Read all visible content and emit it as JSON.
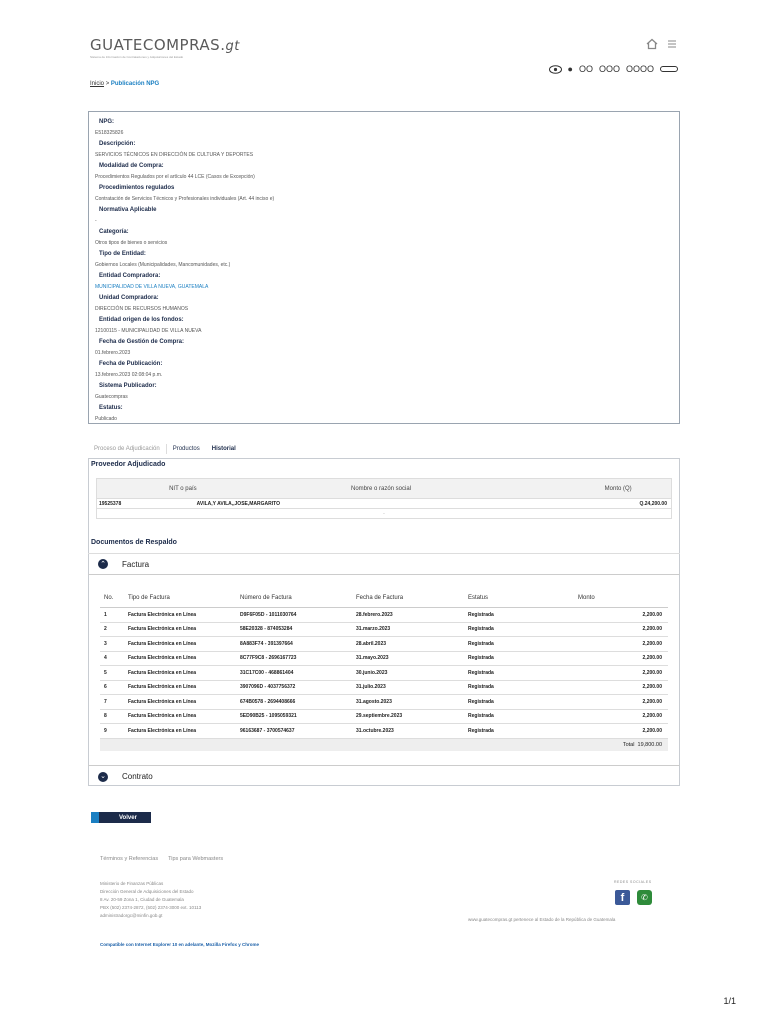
{
  "header": {
    "logo_text": "GUATECOMPRAS.",
    "logo_suffix": "gt",
    "logo_subtext": "Sistema de Información de Contrataciones y Adquisiciones del Estado",
    "access_bar": [
      "●",
      "OO",
      "OOO",
      "OOOO"
    ]
  },
  "breadcrumb": {
    "home": "Inicio",
    "separator": ">",
    "current": "Publicación NPG"
  },
  "detail": {
    "npg_label": "NPG:",
    "npg_value": "E518325826",
    "fields": [
      {
        "label": "Descripción:",
        "value": "SERVICIOS TÉCNICOS EN DIRECCIÓN DE CULTURA Y DEPORTES"
      },
      {
        "label": "Modalidad de Compra:",
        "value": "Procedimientos Regulados por el artículo 44 LCE (Casos de Excepción)"
      },
      {
        "label": "Procedimientos regulados",
        "value": "Contratación de Servicios Técnicos y Profesionales individuales (Art. 44 inciso e)"
      },
      {
        "label": "Normativa Aplicable",
        "value": "-"
      },
      {
        "label": "Categoría:",
        "value": "Otros tipos de bienes o servicios"
      },
      {
        "label": "Tipo de Entidad:",
        "value": "Gobiernos Locales (Municipalidades, Mancomunidades, etc.)"
      },
      {
        "label": "Entidad Compradora:",
        "value": "MUNICIPALIDAD DE VILLA NUEVA, GUATEMALA"
      },
      {
        "label": "Unidad Compradora:",
        "value": "DIRECCIÓN DE RECURSOS HUMANOS"
      },
      {
        "label": "Entidad origen de los fondos:",
        "value": "12100115 - MUNICIPALIDAD DE VILLA NUEVA"
      },
      {
        "label": "Fecha de Gestión de Compra:",
        "value": "01.febrero.2023"
      },
      {
        "label": "Fecha de Publicación:",
        "value": "13.febrero.2023 02:08:04 p.m."
      },
      {
        "label": "Sistema Publicador:",
        "value": "Guatecompras"
      },
      {
        "label": "Estatus:",
        "value": "Publicado"
      }
    ]
  },
  "tabs": [
    "Proceso de Adjudicación",
    "Productos",
    "Historial"
  ],
  "provider": {
    "title": "Proveedor Adjudicado",
    "headers": [
      "NIT o país",
      "Nombre o razón social",
      "Monto (Q)"
    ],
    "row": [
      "19525378",
      "AVILA,Y AVILA,,JOSE,MARGARITO",
      "Q.24,200.00"
    ],
    "empty_row": "-"
  },
  "documents": {
    "title": "Documentos de Respaldo",
    "factura_label": "Factura",
    "contrato_label": "Contrato",
    "headers": [
      "No.",
      "Tipo de Factura",
      "Número de Factura",
      "Fecha de Factura",
      "Estatus",
      "Monto"
    ],
    "rows": [
      [
        "1",
        "Factura Electrónica en Línea",
        "D9F6F05D - 1011030764",
        "28.febrero.2023",
        "Registrada",
        "2,200.00"
      ],
      [
        "2",
        "Factura Electrónica en Línea",
        "58E20328 - 874053284",
        "31.marzo.2023",
        "Registrada",
        "2,200.00"
      ],
      [
        "3",
        "Factura Electrónica en Línea",
        "8A883F74 - 391397664",
        "28.abril.2023",
        "Registrada",
        "2,200.00"
      ],
      [
        "4",
        "Factura Electrónica en Línea",
        "8C77F9C8 - 2696167723",
        "31.mayo.2023",
        "Registrada",
        "2,200.00"
      ],
      [
        "5",
        "Factura Electrónica en Línea",
        "31C17C00 - 468861404",
        "30.junio.2023",
        "Registrada",
        "2,200.00"
      ],
      [
        "6",
        "Factura Electrónica en Línea",
        "3907096D - 4037756372",
        "31.julio.2023",
        "Registrada",
        "2,200.00"
      ],
      [
        "7",
        "Factura Electrónica en Línea",
        "674B0578 - 2694408666",
        "31.agosto.2023",
        "Registrada",
        "2,200.00"
      ],
      [
        "8",
        "Factura Electrónica en Línea",
        "5ED90B25 - 1095059321",
        "29.septiembre.2023",
        "Registrada",
        "2,200.00"
      ],
      [
        "9",
        "Factura Electrónica en Línea",
        "96163687 - 3700574637",
        "31.octubre.2023",
        "Registrada",
        "2,200.00"
      ]
    ],
    "total_label": "Total",
    "total_value": "19,800.00"
  },
  "volver_label": "Volver",
  "footer": {
    "links": [
      "Términos y Referencias",
      "Tips para Webmasters"
    ],
    "address": [
      "Ministerio de Finanzas Públicas",
      "Dirección General de Adquisiciones del Estado",
      "8 Av. 20-59 Zona 1, Ciudad de Guatemala",
      "PBX (502) 2374-2872, (502) 2374-3000 ext. 10113",
      "administradorgc@minfin.gob.gt"
    ],
    "social_label": "REDES SOCIALES",
    "right_text": "www.guatecompras.gt pertenece al Estado de la República de Guatemala",
    "compat": "Compatible con Internet Explorer 10 en adelante, Mozilla Firefox y Chrome"
  },
  "page_number": "1/1"
}
